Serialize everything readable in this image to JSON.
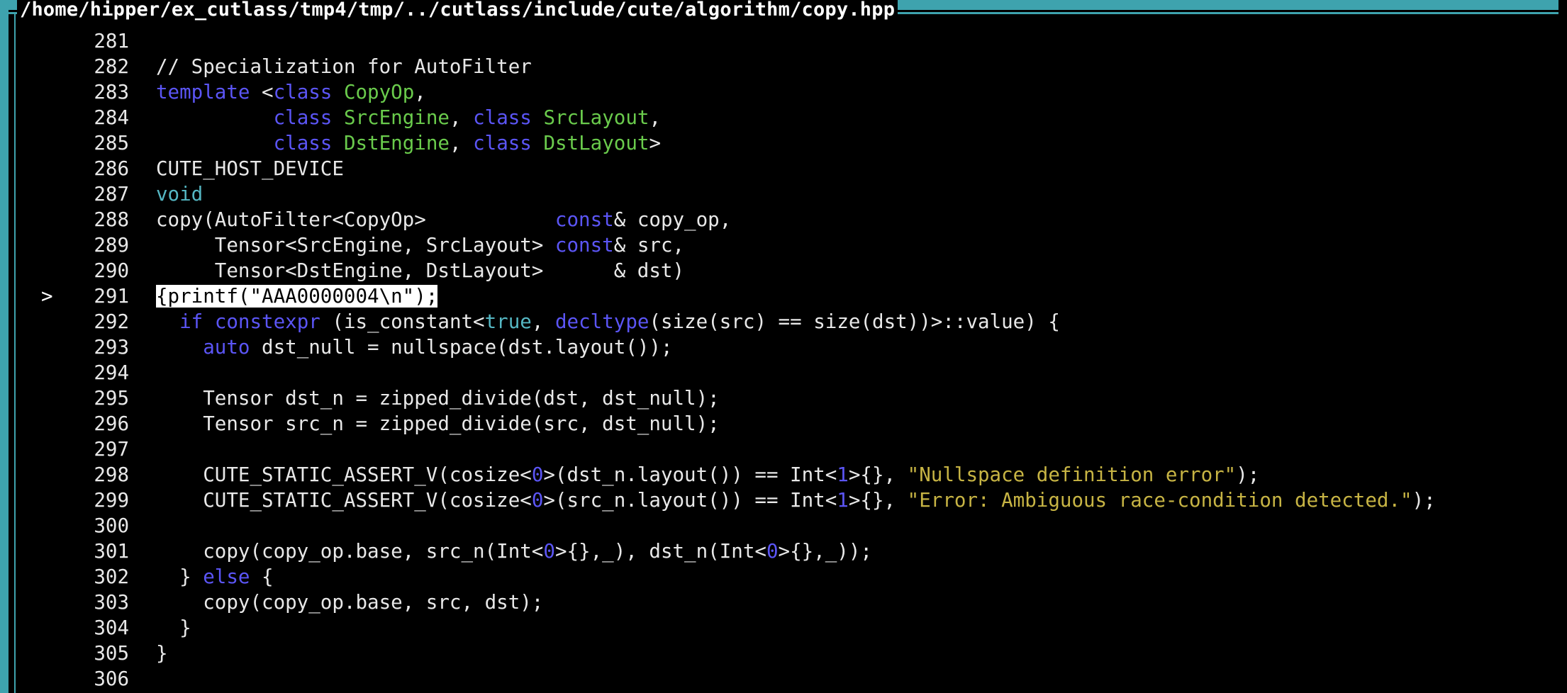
{
  "window": {
    "title": "/home/hipper/ex_cutlass/tmp4/tmp/../cutlass/include/cute/algorithm/copy.hpp",
    "border_color": "#3ea3ae"
  },
  "colors": {
    "keyword": "#5b55f5",
    "type": "#6acb4c",
    "cyan_keyword": "#55b7c3",
    "string": "#c7b444",
    "text": "#e8e8e8",
    "background": "#000000"
  },
  "current_line_marker": ">",
  "lines": [
    {
      "n": "281",
      "marker": "",
      "tokens": []
    },
    {
      "n": "282",
      "marker": "",
      "tokens": [
        {
          "t": "// Specialization for AutoFilter",
          "c": ""
        }
      ]
    },
    {
      "n": "283",
      "marker": "",
      "tokens": [
        {
          "t": "template",
          "c": "kw"
        },
        {
          "t": " <",
          "c": ""
        },
        {
          "t": "class",
          "c": "kw"
        },
        {
          "t": " ",
          "c": ""
        },
        {
          "t": "CopyOp",
          "c": "ty"
        },
        {
          "t": ",",
          "c": ""
        }
      ]
    },
    {
      "n": "284",
      "marker": "",
      "tokens": [
        {
          "t": "          ",
          "c": ""
        },
        {
          "t": "class",
          "c": "kw"
        },
        {
          "t": " ",
          "c": ""
        },
        {
          "t": "SrcEngine",
          "c": "ty"
        },
        {
          "t": ", ",
          "c": ""
        },
        {
          "t": "class",
          "c": "kw"
        },
        {
          "t": " ",
          "c": ""
        },
        {
          "t": "SrcLayout",
          "c": "ty"
        },
        {
          "t": ",",
          "c": ""
        }
      ]
    },
    {
      "n": "285",
      "marker": "",
      "tokens": [
        {
          "t": "          ",
          "c": ""
        },
        {
          "t": "class",
          "c": "kw"
        },
        {
          "t": " ",
          "c": ""
        },
        {
          "t": "DstEngine",
          "c": "ty"
        },
        {
          "t": ", ",
          "c": ""
        },
        {
          "t": "class",
          "c": "kw"
        },
        {
          "t": " ",
          "c": ""
        },
        {
          "t": "DstLayout",
          "c": "ty"
        },
        {
          "t": ">",
          "c": ""
        }
      ]
    },
    {
      "n": "286",
      "marker": "",
      "tokens": [
        {
          "t": "CUTE_HOST_DEVICE",
          "c": ""
        }
      ]
    },
    {
      "n": "287",
      "marker": "",
      "tokens": [
        {
          "t": "void",
          "c": "cy"
        }
      ]
    },
    {
      "n": "288",
      "marker": "",
      "tokens": [
        {
          "t": "copy(AutoFilter<CopyOp>           ",
          "c": ""
        },
        {
          "t": "const",
          "c": "kw"
        },
        {
          "t": "& copy_op,",
          "c": ""
        }
      ]
    },
    {
      "n": "289",
      "marker": "",
      "tokens": [
        {
          "t": "     Tensor<SrcEngine, SrcLayout> ",
          "c": ""
        },
        {
          "t": "const",
          "c": "kw"
        },
        {
          "t": "& src,",
          "c": ""
        }
      ]
    },
    {
      "n": "290",
      "marker": "",
      "tokens": [
        {
          "t": "     Tensor<DstEngine, DstLayout>      & dst)",
          "c": ""
        }
      ]
    },
    {
      "n": "291",
      "marker": ">",
      "tokens": [
        {
          "t": "{printf(\"AAA0000004\\n\");",
          "c": "hl"
        }
      ]
    },
    {
      "n": "292",
      "marker": "",
      "tokens": [
        {
          "t": "  ",
          "c": ""
        },
        {
          "t": "if",
          "c": "kw"
        },
        {
          "t": " ",
          "c": ""
        },
        {
          "t": "constexpr",
          "c": "kw"
        },
        {
          "t": " (is_constant<",
          "c": ""
        },
        {
          "t": "true",
          "c": "cy"
        },
        {
          "t": ", ",
          "c": ""
        },
        {
          "t": "decltype",
          "c": "kw"
        },
        {
          "t": "(size(src) == size(dst))>::value) {",
          "c": ""
        }
      ]
    },
    {
      "n": "293",
      "marker": "",
      "tokens": [
        {
          "t": "    ",
          "c": ""
        },
        {
          "t": "auto",
          "c": "kw"
        },
        {
          "t": " dst_null = nullspace(dst.layout());",
          "c": ""
        }
      ]
    },
    {
      "n": "294",
      "marker": "",
      "tokens": []
    },
    {
      "n": "295",
      "marker": "",
      "tokens": [
        {
          "t": "    Tensor dst_n = zipped_divide(dst, dst_null);",
          "c": ""
        }
      ]
    },
    {
      "n": "296",
      "marker": "",
      "tokens": [
        {
          "t": "    Tensor src_n = zipped_divide(src, dst_null);",
          "c": ""
        }
      ]
    },
    {
      "n": "297",
      "marker": "",
      "tokens": []
    },
    {
      "n": "298",
      "marker": "",
      "tokens": [
        {
          "t": "    CUTE_STATIC_ASSERT_V(cosize<",
          "c": ""
        },
        {
          "t": "0",
          "c": "num"
        },
        {
          "t": ">(dst_n.layout()) == Int<",
          "c": ""
        },
        {
          "t": "1",
          "c": "num"
        },
        {
          "t": ">{}, ",
          "c": ""
        },
        {
          "t": "\"Nullspace definition error\"",
          "c": "str"
        },
        {
          "t": ");",
          "c": ""
        }
      ]
    },
    {
      "n": "299",
      "marker": "",
      "tokens": [
        {
          "t": "    CUTE_STATIC_ASSERT_V(cosize<",
          "c": ""
        },
        {
          "t": "0",
          "c": "num"
        },
        {
          "t": ">(src_n.layout()) == Int<",
          "c": ""
        },
        {
          "t": "1",
          "c": "num"
        },
        {
          "t": ">{}, ",
          "c": ""
        },
        {
          "t": "\"Error: Ambiguous race-condition detected.\"",
          "c": "str"
        },
        {
          "t": ");",
          "c": ""
        }
      ]
    },
    {
      "n": "300",
      "marker": "",
      "tokens": []
    },
    {
      "n": "301",
      "marker": "",
      "tokens": [
        {
          "t": "    copy(copy_op.base, src_n(Int<",
          "c": ""
        },
        {
          "t": "0",
          "c": "num"
        },
        {
          "t": ">{},_), dst_n(Int<",
          "c": ""
        },
        {
          "t": "0",
          "c": "num"
        },
        {
          "t": ">{},_));",
          "c": ""
        }
      ]
    },
    {
      "n": "302",
      "marker": "",
      "tokens": [
        {
          "t": "  } ",
          "c": ""
        },
        {
          "t": "else",
          "c": "kw"
        },
        {
          "t": " {",
          "c": ""
        }
      ]
    },
    {
      "n": "303",
      "marker": "",
      "tokens": [
        {
          "t": "    copy(copy_op.base, src, dst);",
          "c": ""
        }
      ]
    },
    {
      "n": "304",
      "marker": "",
      "tokens": [
        {
          "t": "  }",
          "c": ""
        }
      ]
    },
    {
      "n": "305",
      "marker": "",
      "tokens": [
        {
          "t": "}",
          "c": ""
        }
      ]
    },
    {
      "n": "306",
      "marker": "",
      "tokens": []
    }
  ]
}
